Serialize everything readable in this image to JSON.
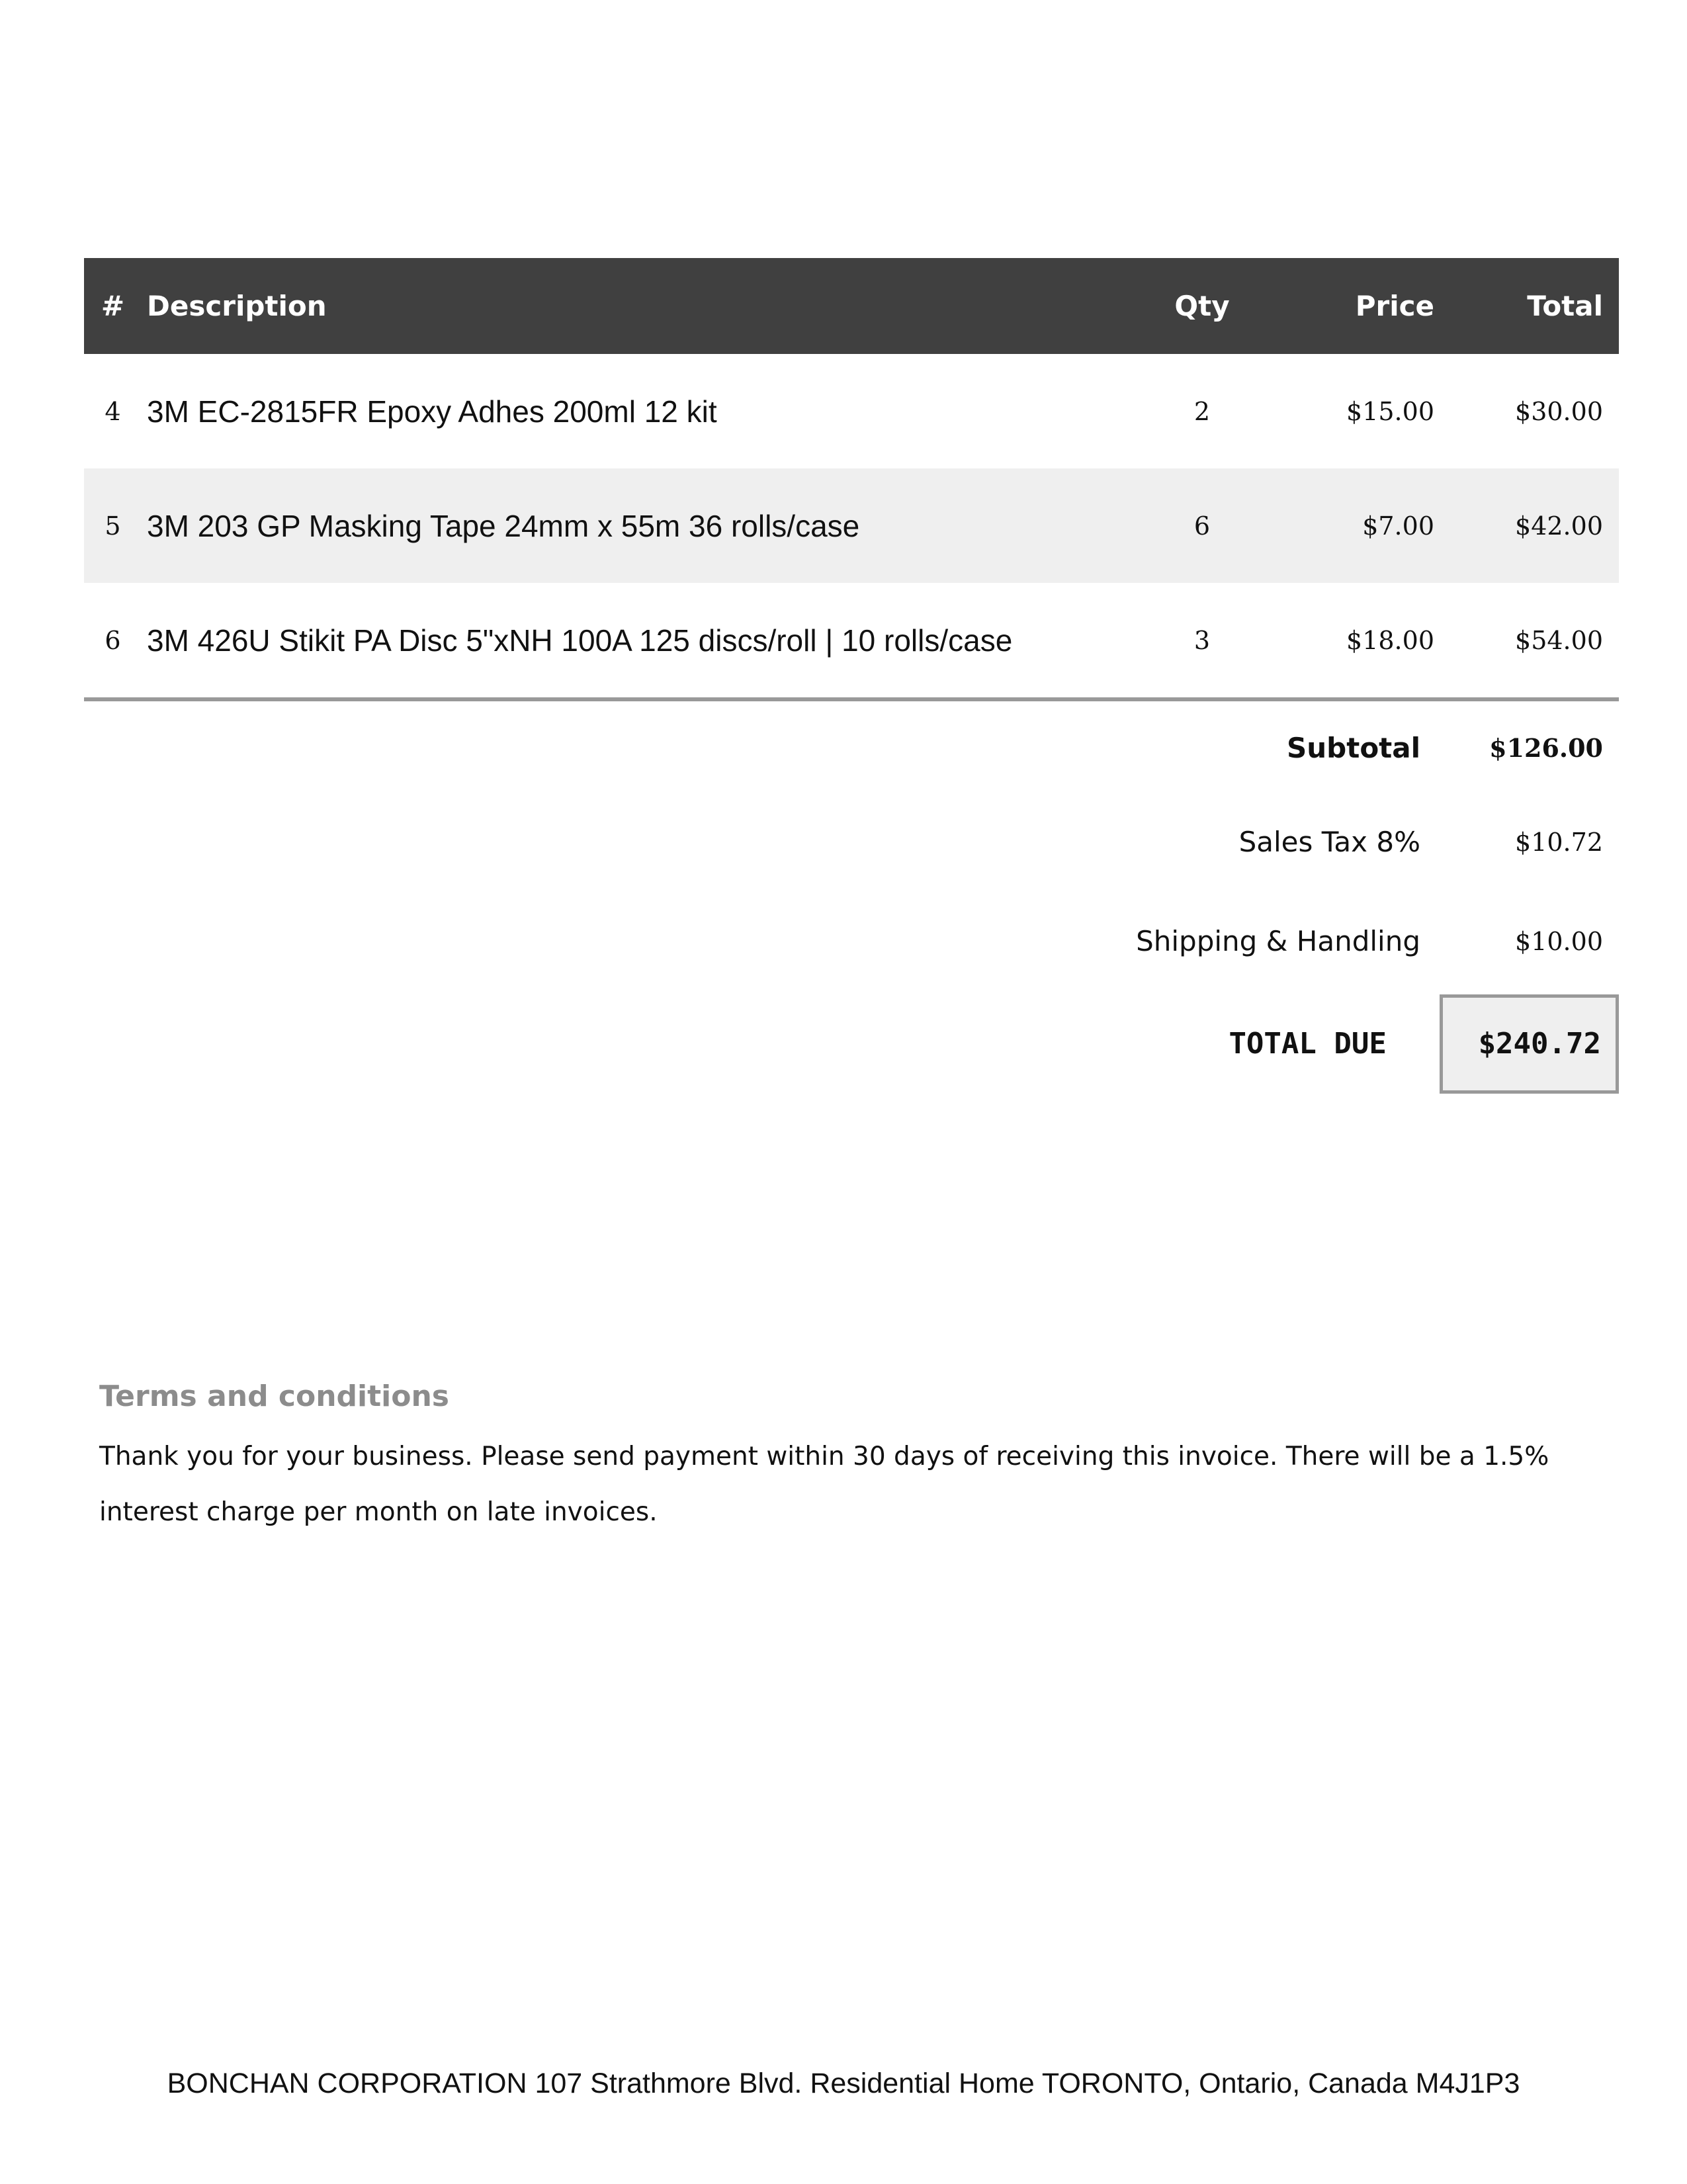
{
  "table": {
    "headers": {
      "num": "#",
      "description": "Description",
      "qty": "Qty",
      "price": "Price",
      "total": "Total"
    },
    "rows": [
      {
        "num": "4",
        "description": "3M EC-2815FR Epoxy Adhes 200ml 12 kit",
        "qty": "2",
        "price": "$15.00",
        "total": "$30.00"
      },
      {
        "num": "5",
        "description": "3M 203 GP Masking Tape 24mm x 55m 36 rolls/case",
        "qty": "6",
        "price": "$7.00",
        "total": "$42.00"
      },
      {
        "num": "6",
        "description": "3M 426U Stikit PA Disc 5\"xNH 100A 125 discs/roll | 10 rolls/case",
        "qty": "3",
        "price": "$18.00",
        "total": "$54.00"
      }
    ]
  },
  "totals": {
    "subtotal_label": "Subtotal",
    "subtotal_value": "$126.00",
    "tax_label": "Sales Tax 8%",
    "tax_value": "$10.72",
    "shipping_label": "Shipping & Handling",
    "shipping_value": "$10.00",
    "due_label": "TOTAL DUE",
    "due_value": "$240.72"
  },
  "terms": {
    "title": "Terms and conditions",
    "body": "Thank you for your business. Please send payment within 30 days of receiving this invoice. There will be a 1.5% interest charge per month on late invoices."
  },
  "footer": {
    "address": "BONCHAN CORPORATION 107 Strathmore Blvd. Residential Home TORONTO, Ontario, Canada M4J1P3"
  },
  "colors": {
    "header_bg": "#404040",
    "row_alt_bg": "#efefef",
    "rule": "#999999",
    "terms_title": "#8c8c8c"
  }
}
